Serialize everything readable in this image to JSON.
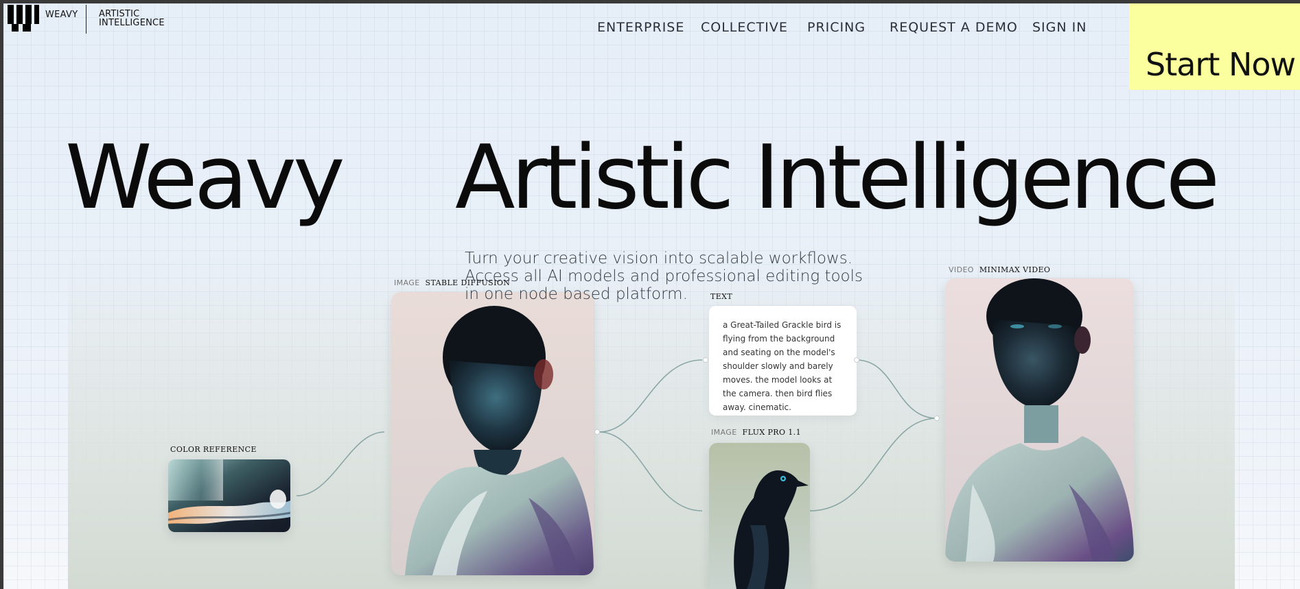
{
  "header": {
    "brand_name": "WEAVY",
    "brand_tagline": "ARTISTIC\nINTELLIGENCE",
    "nav": [
      "ENTERPRISE",
      "COLLECTIVE",
      "PRICING",
      "REQUEST A DEMO",
      "SIGN IN"
    ],
    "cta_label": "Start Now",
    "cta_color": "#fbff9e"
  },
  "hero": {
    "title_left": "Weavy",
    "title_right": "Artistic Intelligence",
    "subtitle_lines": [
      "Turn your creative vision into scalable workflows.",
      "Access all AI models and professional editing tools",
      "in one node based platform."
    ]
  },
  "nodes": {
    "color_reference": {
      "label": "COLOR REFERENCE"
    },
    "stable_diffusion": {
      "kind": "IMAGE",
      "model": "STABLE DIFFUSION"
    },
    "text": {
      "label": "TEXT",
      "content": "a Great-Tailed Grackle bird is flying from the background and seating on the model's shoulder slowly and barely moves. the model looks at the camera. then bird flies away. cinematic."
    },
    "flux": {
      "kind": "IMAGE",
      "model": "FLUX PRO 1.1"
    },
    "minimax": {
      "kind": "VIDEO",
      "model": "MINIMAX VIDEO"
    }
  }
}
